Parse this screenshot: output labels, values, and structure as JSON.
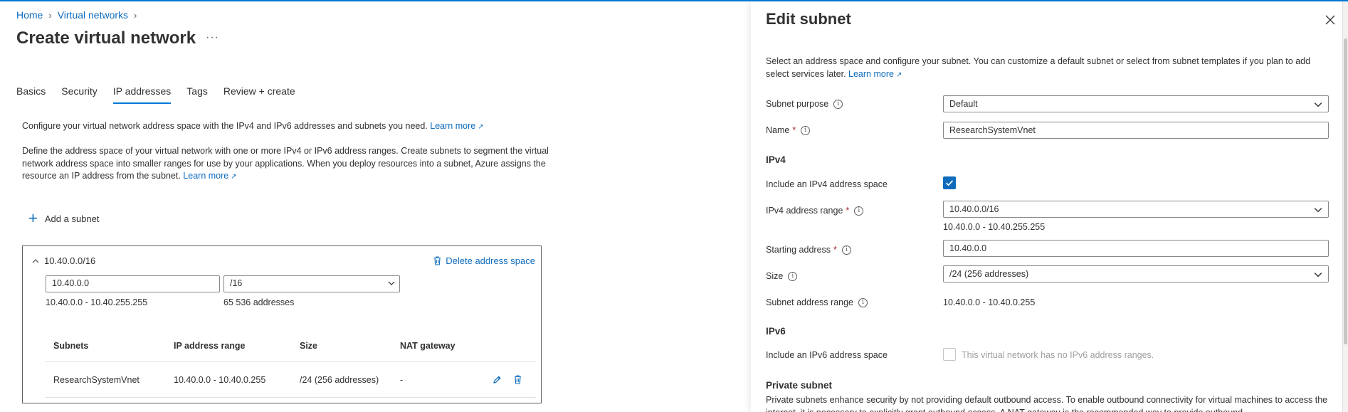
{
  "breadcrumb": {
    "home": "Home",
    "virtual_networks": "Virtual networks"
  },
  "page": {
    "title": "Create virtual network",
    "more": "···"
  },
  "tabs": [
    {
      "label": "Basics"
    },
    {
      "label": "Security"
    },
    {
      "label": "IP addresses"
    },
    {
      "label": "Tags"
    },
    {
      "label": "Review + create"
    }
  ],
  "intro": {
    "text": "Configure your virtual network address space with the IPv4 and IPv6 addresses and subnets you need.",
    "learn_more": "Learn more",
    "text2": "Define the address space of your virtual network with one or more IPv4 or IPv6 address ranges. Create subnets to segment the virtual network address space into smaller ranges for use by your applications. When you deploy resources into a subnet, Azure assigns the resource an IP address from the subnet.",
    "learn_more2": "Learn more"
  },
  "add_subnet": {
    "label": "Add a subnet"
  },
  "address_space": {
    "cidr": "10.40.0.0/16",
    "delete_label": "Delete address space",
    "address_value": "10.40.0.0",
    "prefix_value": "/16",
    "range_note": "10.40.0.0 - 10.40.255.255",
    "count_note": "65 536 addresses"
  },
  "subnet_table": {
    "headers": {
      "subnets": "Subnets",
      "range": "IP address range",
      "size": "Size",
      "nat": "NAT gateway"
    },
    "rows": [
      {
        "name": "ResearchSystemVnet",
        "range": "10.40.0.0 - 10.40.0.255",
        "size": "/24 (256 addresses)",
        "nat": "-"
      }
    ]
  },
  "panel": {
    "title": "Edit subnet",
    "description": "Select an address space and configure your subnet. You can customize a default subnet or select from subnet templates if you plan to add select services later.",
    "learn_more": "Learn more",
    "subnet_purpose_label": "Subnet purpose",
    "subnet_purpose_value": "Default",
    "name_label": "Name",
    "name_value": "ResearchSystemVnet",
    "ipv4_heading": "IPv4",
    "include_ipv4_label": "Include an IPv4 address space",
    "ipv4_range_label": "IPv4 address range",
    "ipv4_range_value": "10.40.0.0/16",
    "ipv4_range_note": "10.40.0.0 - 10.40.255.255",
    "starting_address_label": "Starting address",
    "starting_address_value": "10.40.0.0",
    "size_label": "Size",
    "size_value": "/24 (256 addresses)",
    "subnet_range_label": "Subnet address range",
    "subnet_range_value": "10.40.0.0 - 10.40.0.255",
    "ipv6_heading": "IPv6",
    "include_ipv6_label": "Include an IPv6 address space",
    "ipv6_disabled_note": "This virtual network has no IPv6 address ranges.",
    "private_heading": "Private subnet",
    "private_desc": "Private subnets enhance security by not providing default outbound access. To enable outbound connectivity for virtual machines to access the internet, it is necessary to explicitly grant outbound access. A NAT gateway is the recommended way to provide outbound"
  },
  "colors": {
    "accent": "#0f6cbd",
    "required": "#a4262c",
    "border": "#8a8886"
  },
  "icons": [
    "chevron-right-icon",
    "more-icon",
    "external-link-icon",
    "plus-icon",
    "chevron-up-icon",
    "trash-icon",
    "chevron-down-icon",
    "pencil-icon",
    "close-icon",
    "info-icon",
    "checkmark-icon"
  ]
}
